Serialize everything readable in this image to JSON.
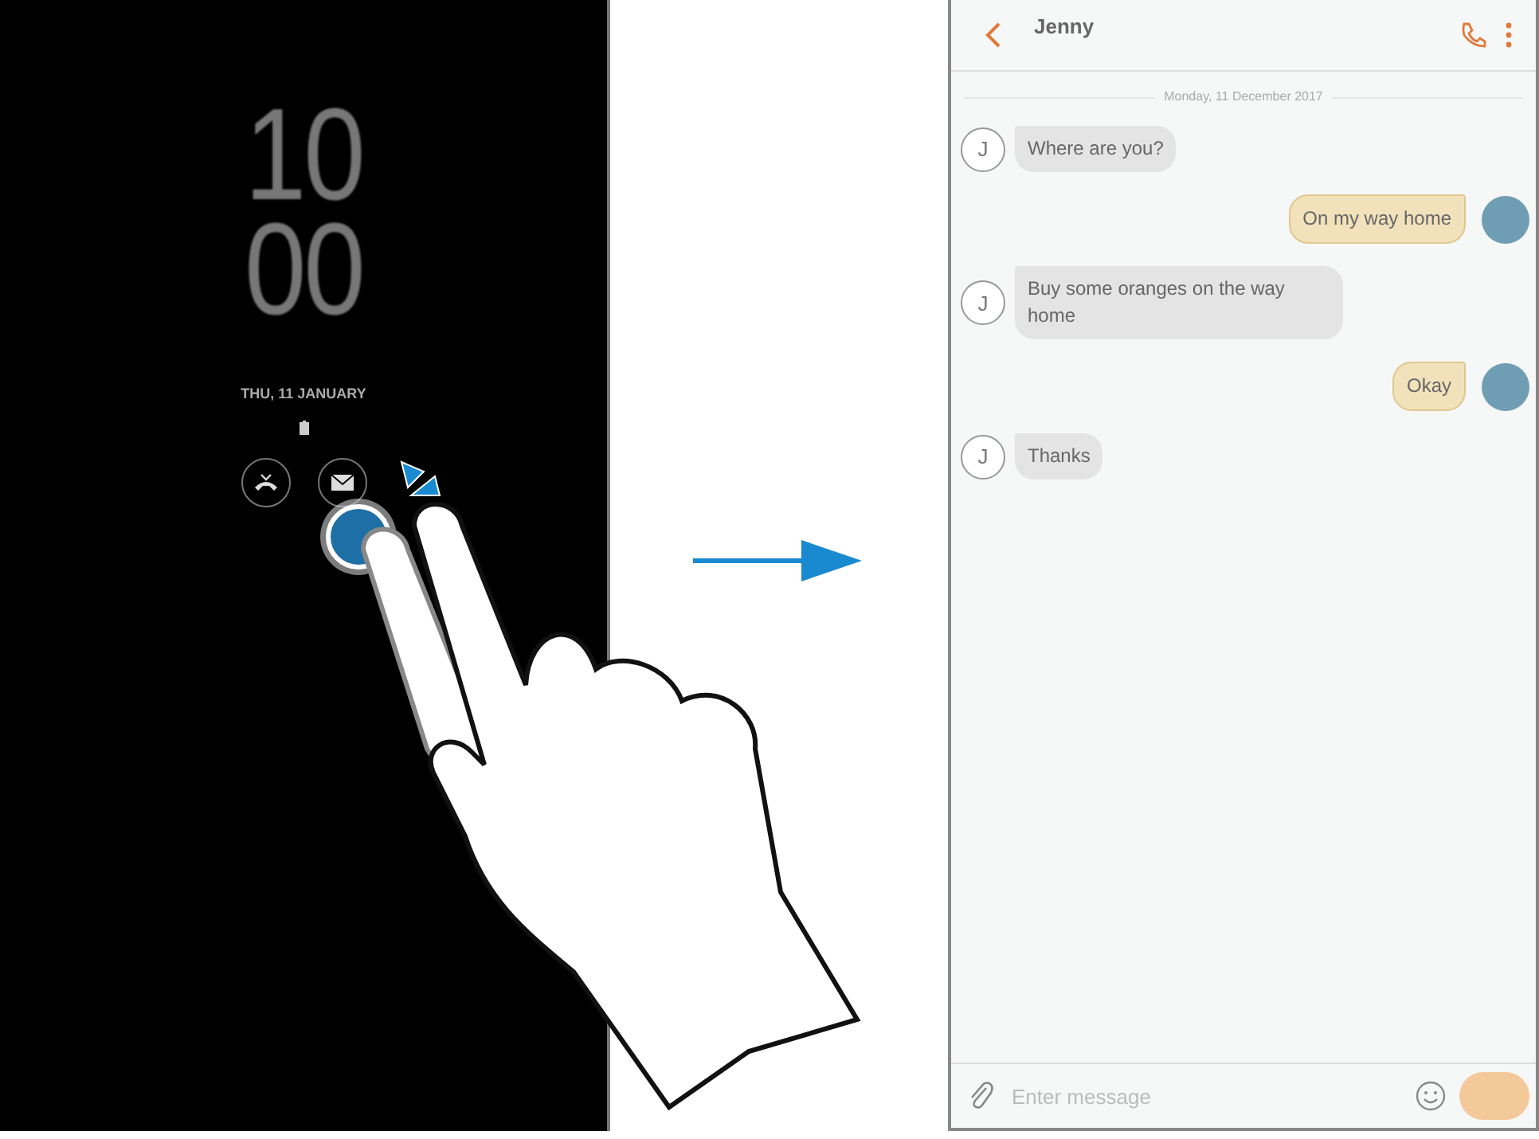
{
  "lock_screen": {
    "time_hours": "10",
    "time_minutes": "00",
    "date": "THU, 11 JANUARY",
    "notifications": [
      {
        "kind": "missed-call"
      },
      {
        "kind": "message"
      }
    ]
  },
  "chat": {
    "contact_name": "Jenny",
    "date_divider": "Monday, 11 December 2017",
    "messages": [
      {
        "kind": "incoming",
        "avatar_letter": "J",
        "text": "Where are you?"
      },
      {
        "kind": "outgoing",
        "text": "On my way home"
      },
      {
        "kind": "incoming",
        "avatar_letter": "J",
        "text": "Buy some oranges on the way home"
      },
      {
        "kind": "outgoing",
        "text": "Okay"
      },
      {
        "kind": "incoming",
        "avatar_letter": "J",
        "text": "Thanks"
      }
    ],
    "input": {
      "placeholder": "Enter message"
    }
  }
}
